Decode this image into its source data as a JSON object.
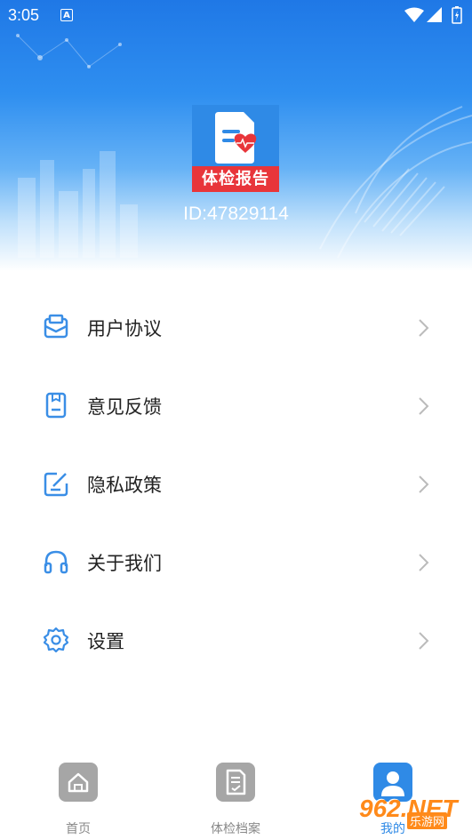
{
  "status_bar": {
    "time": "3:05",
    "notification_icon": "A"
  },
  "profile": {
    "logo_banner_text": "体检报告",
    "user_id": "ID:47829114"
  },
  "menu": [
    {
      "label": "用户协议",
      "icon": "mail-icon"
    },
    {
      "label": "意见反馈",
      "icon": "feedback-icon"
    },
    {
      "label": "隐私政策",
      "icon": "edit-icon"
    },
    {
      "label": "关于我们",
      "icon": "headphones-icon"
    },
    {
      "label": "设置",
      "icon": "gear-icon"
    }
  ],
  "tabs": [
    {
      "label": "首页",
      "icon": "home-icon",
      "active": false
    },
    {
      "label": "体检档案",
      "icon": "document-icon",
      "active": false
    },
    {
      "label": "我的",
      "icon": "user-icon",
      "active": true
    }
  ],
  "watermark": {
    "text": "962.NET",
    "sub": "乐游网"
  },
  "colors": {
    "accent": "#2f8ae6",
    "banner_red": "#e8353a",
    "tab_inactive": "#999999",
    "icon_blue": "#3a8ee6"
  }
}
